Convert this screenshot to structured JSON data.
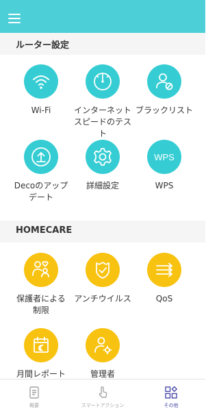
{
  "router_section": {
    "title": "ルーター設定"
  },
  "router_items": [
    {
      "line1": "Wi-Fi",
      "line2": ""
    },
    {
      "line1": "インターネット",
      "line2": "スピードのテスト"
    },
    {
      "line1": "ブラックリスト",
      "line2": ""
    },
    {
      "line1": "Decoのアップ",
      "line2": "デート"
    },
    {
      "line1": "詳細設定",
      "line2": ""
    },
    {
      "line1": "WPS",
      "line2": ""
    }
  ],
  "wps_icon_text": "WPS",
  "homecare_section": {
    "title": "HOMECARE"
  },
  "homecare_items": [
    {
      "line1": "保護者による",
      "line2": "制限"
    },
    {
      "line1": "アンチウイルス",
      "line2": ""
    },
    {
      "line1": "QoS",
      "line2": ""
    },
    {
      "line1": "月間レポート",
      "line2": ""
    },
    {
      "line1": "管理者",
      "line2": ""
    }
  ],
  "bottom_nav": [
    {
      "label": "概要",
      "active": false
    },
    {
      "label": "スマートアクション",
      "active": false
    },
    {
      "label": "その他",
      "active": true
    }
  ],
  "colors": {
    "header": "#4ccfd7",
    "teal": "#35cdd3",
    "yellow": "#f8c210",
    "nav_active": "#4a4aa8",
    "nav_inactive": "#a4a4a4"
  }
}
